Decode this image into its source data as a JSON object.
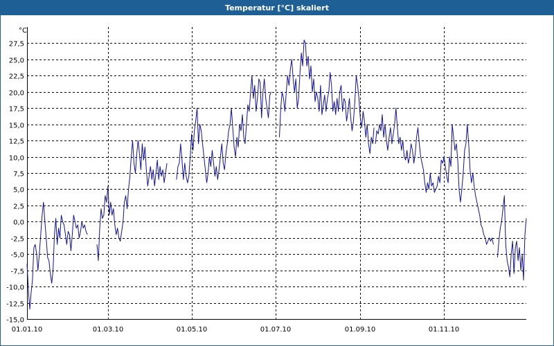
{
  "window": {
    "title": "Temperatur [°C] skaliert"
  },
  "chart_data": {
    "type": "line",
    "title": "Temperatur [°C] skaliert",
    "ylabel": "°C",
    "xlabel": "",
    "ylim": [
      -15,
      30
    ],
    "xlim": [
      0,
      364
    ],
    "grid": true,
    "legend": "none",
    "y_ticks": [
      -15.0,
      -12.5,
      -10.0,
      -7.5,
      -5.0,
      -2.5,
      0.0,
      2.5,
      5.0,
      7.5,
      10.0,
      12.5,
      15.0,
      17.5,
      20.0,
      22.5,
      25.0,
      27.5
    ],
    "y_tick_labels": [
      "-15,0",
      "-12,5",
      "-10,0",
      "-7,5",
      "-5,0",
      "-2,5",
      "0,0",
      "2,5",
      "5,0",
      "7,5",
      "10,0",
      "12,5",
      "15,0",
      "17,5",
      "20,0",
      "22,5",
      "25,0",
      "27,5"
    ],
    "x_ticks": [
      0,
      59,
      120,
      181,
      243,
      304
    ],
    "x_tick_labels": [
      "01.01.10",
      "01.03.10",
      "01.05.10",
      "01.07.10",
      "01.09.10",
      "01.11.10"
    ],
    "line_color": "#1010a0",
    "series": [
      {
        "segments": [
          {
            "x": [
              0,
              1,
              2,
              3,
              4,
              5,
              6,
              7,
              8,
              9,
              10,
              11,
              12,
              13,
              14,
              15,
              16,
              17,
              18,
              19,
              20,
              21,
              22,
              23,
              24,
              25,
              26,
              27,
              28,
              29,
              30,
              31,
              32,
              33,
              34,
              35,
              36,
              37,
              38,
              39,
              40,
              41,
              42,
              43,
              44
            ],
            "y": [
              -6.5,
              -10.5,
              -13.5,
              -11,
              -9,
              -4,
              -3.5,
              -5,
              -7.5,
              -5,
              -2,
              1,
              3,
              0,
              -2.5,
              -5.5,
              -6,
              -8,
              -9.5,
              -7.5,
              -2,
              0.5,
              -3.5,
              -1,
              -2.5,
              1,
              0,
              -0.5,
              -2,
              -3.5,
              -1.5,
              -2,
              -4.5,
              -2,
              1,
              0,
              -1,
              -0.5,
              -2.5,
              -1.5,
              0,
              -1,
              -0.5,
              -1.5,
              -2
            ]
          },
          {
            "x": [
              51,
              52,
              53,
              54,
              55,
              56,
              57,
              58,
              59,
              60,
              61,
              62,
              63,
              64,
              65,
              66,
              67,
              68,
              69,
              70,
              71,
              72,
              73,
              74,
              75,
              76,
              77,
              78,
              79,
              80,
              81,
              82,
              83,
              84,
              85,
              86,
              87,
              88,
              89,
              90,
              91,
              92,
              93,
              94,
              95,
              96,
              97,
              98,
              99,
              100,
              101,
              102
            ],
            "y": [
              -3.5,
              -6,
              -1,
              2,
              0.5,
              1,
              4,
              3,
              5.5,
              1,
              3,
              1,
              2,
              -0.5,
              -2,
              -1,
              -2.5,
              -3,
              -1.5,
              0,
              3,
              4,
              2,
              5,
              7,
              10,
              12.5,
              9,
              7.5,
              10.5,
              12.5,
              10.5,
              8,
              12,
              9.5,
              11.5,
              8,
              5.5,
              7,
              8.5,
              6.5,
              8,
              5.5,
              7.5,
              9.5,
              6.5,
              8.5,
              7,
              8,
              6,
              7.5,
              9
            ]
          },
          {
            "x": [
              109,
              110,
              111,
              112,
              113,
              114,
              115,
              116,
              117,
              118,
              119,
              120,
              121,
              122,
              123,
              124,
              125,
              126,
              127,
              128,
              129,
              130,
              131,
              132,
              133,
              134,
              135,
              136,
              137,
              138,
              139,
              140,
              141,
              142,
              143,
              144,
              145,
              146,
              147,
              148,
              149,
              150,
              151,
              152,
              153,
              154,
              155,
              156,
              157,
              158,
              159,
              160,
              161,
              162,
              163,
              164,
              165,
              166,
              167,
              168,
              169,
              170,
              171,
              172,
              173,
              174,
              175,
              176,
              177,
              178
            ],
            "y": [
              6.5,
              8.5,
              9,
              12,
              9.5,
              6.5,
              9,
              7,
              6,
              7,
              10,
              13.5,
              11,
              14,
              15.5,
              17.5,
              12,
              15,
              14,
              12,
              10,
              8,
              6,
              7.5,
              10,
              8.5,
              11,
              9,
              7,
              8.5,
              6.5,
              8,
              10,
              12,
              9,
              8,
              10.5,
              12,
              14,
              15,
              17.5,
              14.5,
              11.5,
              10,
              13,
              11.5,
              15,
              14,
              16.5,
              13,
              12,
              15,
              18,
              17,
              20,
              22.5,
              19,
              21,
              17,
              19,
              22,
              21.5,
              16,
              20,
              22,
              19,
              17.5,
              16,
              19.5,
              20
            ]
          },
          {
            "x": [
              184,
              185,
              186,
              187,
              188,
              189,
              190,
              191,
              192,
              193,
              194,
              195,
              196,
              197,
              198,
              199,
              200,
              201,
              202,
              203,
              204,
              205,
              206,
              207,
              208,
              209,
              210,
              211,
              212,
              213,
              214,
              215,
              216,
              217,
              218,
              219,
              220,
              221,
              222,
              223,
              224,
              225,
              226,
              227,
              228,
              229,
              230,
              231,
              232,
              233,
              234,
              235,
              236,
              237,
              238,
              239,
              240,
              241,
              242,
              243,
              244,
              245,
              246,
              247,
              248,
              249,
              250,
              251,
              252,
              253
            ],
            "y": [
              13,
              17.5,
              20,
              19,
              17,
              20,
              22.5,
              21,
              23.5,
              25,
              22,
              20,
              22,
              17.5,
              19,
              23,
              26,
              24,
              28,
              27.5,
              24,
              25.5,
              22,
              24,
              20,
              22,
              18.5,
              20,
              19,
              17,
              21,
              16.5,
              18,
              19.5,
              17,
              19,
              20,
              23,
              21,
              17,
              18.5,
              16.5,
              19,
              17,
              20,
              21,
              17,
              19,
              18.5,
              15.5,
              17,
              19,
              16,
              14,
              15.5,
              18.5,
              22.5,
              21,
              19,
              16,
              14.5,
              17,
              15.5,
              13,
              15,
              12,
              10.5,
              13,
              12,
              14.5
            ]
          },
          {
            "x": [
              254,
              255,
              256,
              257,
              258,
              259,
              260,
              261,
              262,
              263,
              264,
              265,
              266,
              267,
              268,
              269,
              270,
              271,
              272,
              273,
              274,
              275,
              276,
              277,
              278,
              279,
              280,
              281,
              282,
              283,
              284,
              285,
              286,
              287,
              288,
              289,
              290,
              291,
              292,
              293,
              294,
              295,
              296,
              297,
              298,
              299,
              300,
              301,
              302,
              303,
              304,
              305,
              306,
              307,
              308,
              309,
              310,
              311,
              312,
              313,
              314,
              315,
              316,
              317,
              318,
              319,
              320,
              321,
              322,
              323,
              324,
              325,
              326,
              327,
              328,
              329,
              330,
              331,
              332,
              333,
              334,
              335,
              336,
              337,
              338,
              339,
              340
            ],
            "y": [
              12,
              14,
              13.5,
              15,
              14,
              16.5,
              13,
              15,
              12.5,
              11,
              13,
              14.5,
              12,
              13.5,
              15,
              17.5,
              14.5,
              12,
              13,
              11,
              12.5,
              10,
              9.5,
              11,
              9,
              10,
              12,
              11,
              9,
              10.5,
              13,
              14.5,
              12,
              10,
              9,
              8,
              6,
              4.5,
              6,
              5,
              7.5,
              5.5,
              6,
              4.5,
              5,
              5.5,
              7,
              6,
              9.5,
              9,
              10,
              8.5,
              7,
              6,
              10,
              8.5,
              15,
              13,
              11,
              12,
              9.5,
              5,
              3,
              5,
              7.5,
              11,
              12,
              15,
              12,
              8,
              6,
              7.5,
              5.5,
              4,
              3,
              2,
              1,
              -0.5,
              -1,
              -2,
              -2.5,
              -3.5,
              -3,
              -2.5,
              -3,
              -2.5,
              -3.5
            ]
          },
          {
            "x": [
              343,
              344,
              345,
              346,
              347,
              348,
              349,
              350,
              351,
              352,
              353,
              354,
              355,
              356,
              357,
              358,
              359,
              360,
              361,
              362,
              363,
              364
            ],
            "y": [
              -5.5,
              -3,
              -1,
              0,
              2,
              4,
              -3.5,
              -6,
              -7,
              -8.5,
              -5,
              -3,
              -8,
              -4,
              -3,
              -6,
              -4,
              -7.5,
              -5,
              -9,
              -2,
              0.5
            ]
          }
        ]
      }
    ]
  }
}
